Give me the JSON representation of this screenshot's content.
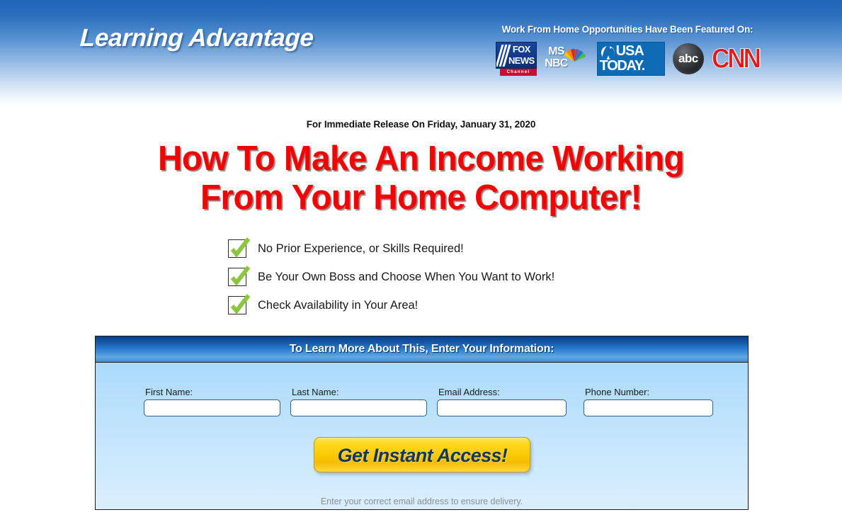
{
  "header": {
    "brand": "Learning Advantage",
    "media_caption": "Work From Home Opportunities Have Been Featured On:",
    "logos": [
      {
        "name": "fox-news",
        "line1": "FOX",
        "line2": "NEWS",
        "sub": "Channel"
      },
      {
        "name": "msnbc",
        "line1": "MS",
        "line2": "NBC"
      },
      {
        "name": "usa-today",
        "line1": "USA",
        "line2": "TODAY."
      },
      {
        "name": "abc",
        "text": "abc"
      },
      {
        "name": "cnn",
        "text": "CNN"
      }
    ],
    "colors": {
      "gradient_top": "#1f64b8",
      "gradient_bottom": "#ffffff"
    }
  },
  "main": {
    "release_date": "For Immediate Release On Friday, January 31, 2020",
    "headline_line1": "How To Make An Income Working",
    "headline_line2": "From Your Home Computer!",
    "headline_color": "#f50000",
    "bullets": [
      {
        "icon": "green-check-icon",
        "text": "No Prior Experience, or Skills Required!"
      },
      {
        "icon": "green-check-icon",
        "text": "Be Your Own Boss and Choose When You Want to Work!"
      },
      {
        "icon": "green-check-icon",
        "text": "Check Availability in Your Area!"
      }
    ],
    "check_color": "#8cc63e"
  },
  "form": {
    "title": "To Learn More About This, Enter Your Information:",
    "fields": [
      {
        "label": "First Name:",
        "value": "",
        "placeholder": ""
      },
      {
        "label": "Last Name:",
        "value": "",
        "placeholder": ""
      },
      {
        "label": "Email Address:",
        "value": "",
        "placeholder": ""
      },
      {
        "label": "Phone Number:",
        "value": "",
        "placeholder": ""
      }
    ],
    "cta_label": "Get Instant Access!",
    "cta_color": "#fccb04",
    "note": "Enter your correct email address to ensure delivery."
  }
}
